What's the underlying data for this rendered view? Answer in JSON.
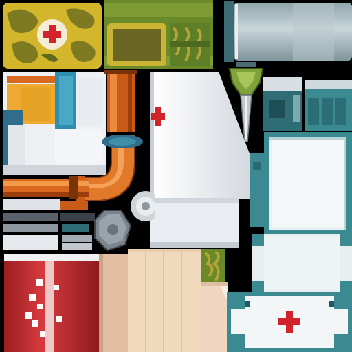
{
  "atlas": {
    "regions": [
      {
        "name": "camo-medkit",
        "icon": "red-cross-icon"
      },
      {
        "name": "camo-strip",
        "icon": ""
      },
      {
        "name": "steel-canister",
        "icon": ""
      },
      {
        "name": "grabber-claw",
        "icon": "claw-icon"
      },
      {
        "name": "teal-device",
        "icon": ""
      },
      {
        "name": "white-panel",
        "icon": ""
      },
      {
        "name": "orange-bar",
        "icon": ""
      },
      {
        "name": "pipe-elbow",
        "icon": "pipe-icon"
      },
      {
        "name": "big-white-panel",
        "icon": "red-cross-icon"
      },
      {
        "name": "white-lower-panel",
        "icon": ""
      },
      {
        "name": "teal-frame",
        "icon": ""
      },
      {
        "name": "long-pipe",
        "icon": ""
      },
      {
        "name": "metal-strips",
        "icon": ""
      },
      {
        "name": "hex-bolt",
        "icon": "bolt-icon"
      },
      {
        "name": "round-disc",
        "icon": ""
      },
      {
        "name": "red-canister",
        "icon": ""
      },
      {
        "name": "tan-block",
        "icon": ""
      },
      {
        "name": "wood-planks",
        "icon": ""
      },
      {
        "name": "camo-thin",
        "icon": ""
      },
      {
        "name": "tan-small",
        "icon": ""
      },
      {
        "name": "medkit-top",
        "icon": ""
      },
      {
        "name": "medkit-front",
        "icon": "red-cross-icon"
      }
    ]
  },
  "colors": {
    "background": "#000000",
    "camo_yellow": "#d3b62c",
    "camo_olive": "#7d7a22",
    "camo_green": "#4f7a2b",
    "medical_red": "#d2232a",
    "steel": "#a9bcc1",
    "teal": "#3b8a92",
    "teal_dark": "#1f5a63",
    "white_panel": "#e7ebf0",
    "orange": "#d9691e",
    "red_can": "#c2292f",
    "wood": "#f1d9bd",
    "tan": "#e6c4a6",
    "dark_metal": "#59626b"
  }
}
